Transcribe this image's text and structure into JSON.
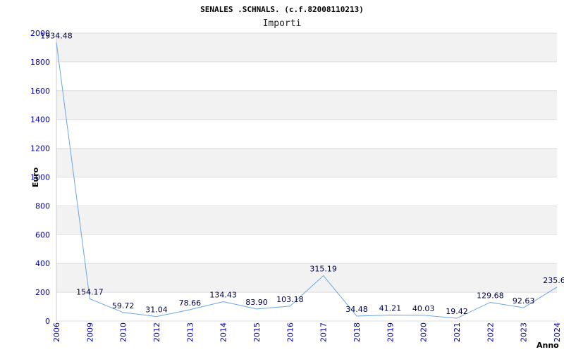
{
  "chart_data": {
    "type": "line",
    "title": "SENALES .SCHNALS. (c.f.82008110213)",
    "subtitle": "Importi",
    "xlabel": "Anno",
    "ylabel": "Euro",
    "ylim": [
      0,
      2000
    ],
    "yticks": [
      "0",
      "200",
      "400",
      "600",
      "800",
      "1000",
      "1200",
      "1400",
      "1600",
      "1800",
      "2000"
    ],
    "grid": true,
    "categories": [
      "2006",
      "2009",
      "2010",
      "2012",
      "2013",
      "2014",
      "2015",
      "2016",
      "2017",
      "2018",
      "2019",
      "2020",
      "2021",
      "2022",
      "2023",
      "2024"
    ],
    "values": [
      1934.48,
      154.17,
      59.72,
      31.04,
      78.66,
      134.43,
      83.9,
      103.18,
      315.19,
      34.48,
      41.21,
      40.03,
      19.42,
      129.68,
      92.63,
      235.6
    ],
    "value_labels": [
      "1934.48",
      "154.17",
      "59.72",
      "31.04",
      "78.66",
      "134.43",
      "83.90",
      "103.18",
      "315.19",
      "34.48",
      "41.21",
      "40.03",
      "19.42",
      "129.68",
      "92.63",
      "235.6"
    ],
    "colors": {
      "line": "#6aa6e0",
      "band": "#f2f2f2",
      "gridline": "#dddddd",
      "tick_text": "#0000aa"
    }
  }
}
